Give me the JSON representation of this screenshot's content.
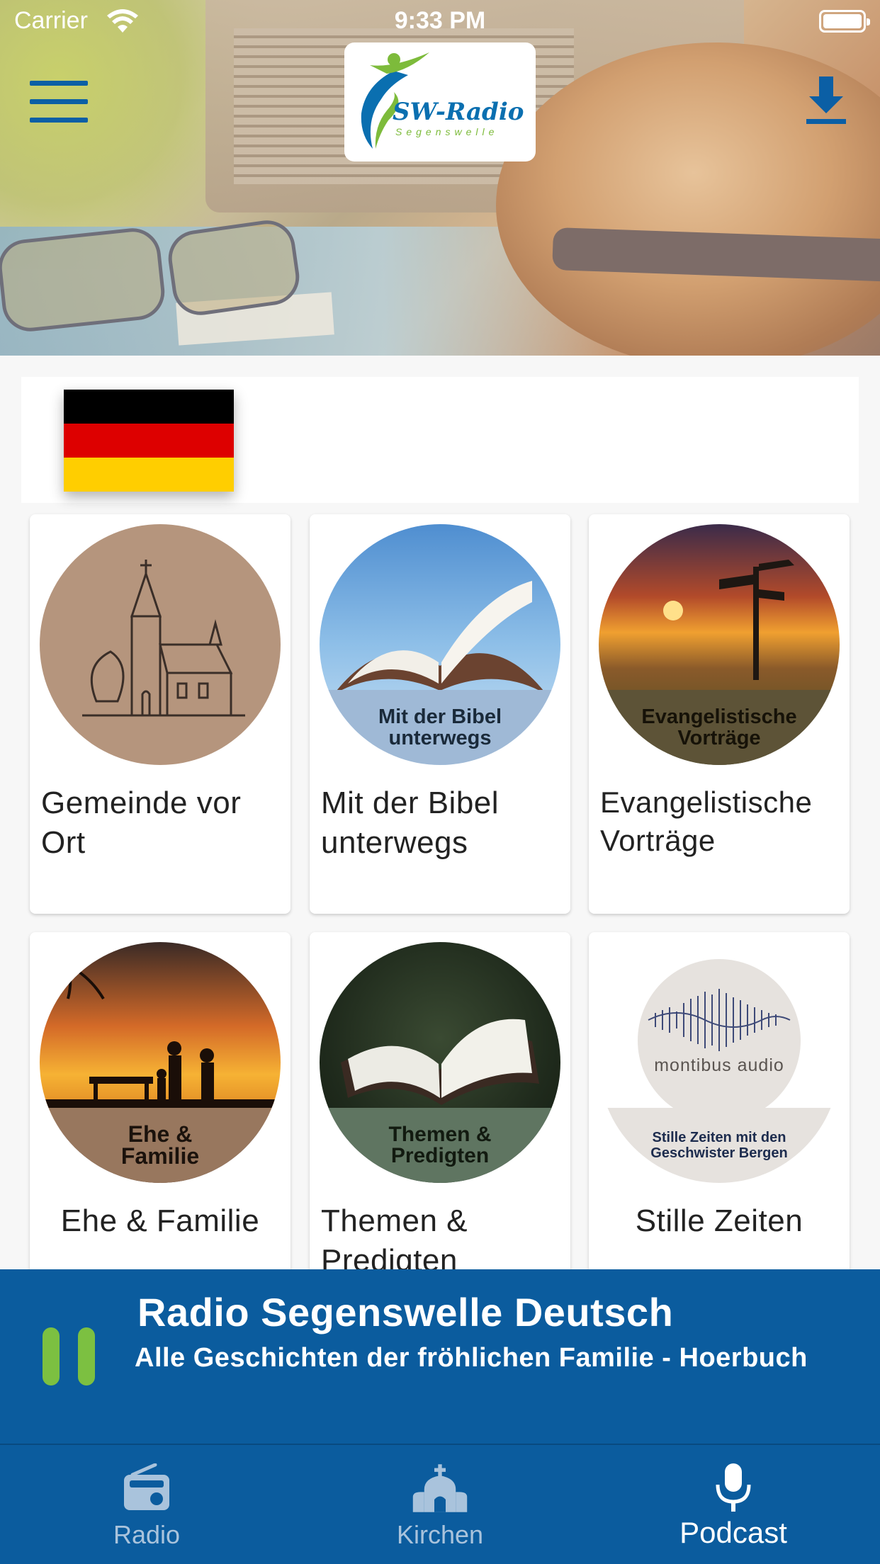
{
  "status_bar": {
    "carrier": "Carrier",
    "time": "9:33 PM"
  },
  "header": {
    "logo_title": "SW-Radio",
    "logo_subtitle": "Segenswelle",
    "menu_icon": "hamburger-menu-icon",
    "download_icon": "download-icon"
  },
  "language": {
    "selected_flag": "germany-flag-icon",
    "colors": [
      "#000000",
      "#dd0000",
      "#ffce00"
    ]
  },
  "categories": [
    {
      "title": "Gemeinde vor Ort",
      "badge": "",
      "badge_color": ""
    },
    {
      "title": "Mit der Bibel unterwegs",
      "badge": "Mit der Bibel unterwegs",
      "badge_color": "#9fb9d6"
    },
    {
      "title": "Evangelistische Vorträge",
      "badge": "Evangelistische Vorträge",
      "badge_color": "#5d5337"
    },
    {
      "title": "Ehe & Familie",
      "badge": "Ehe & Familie",
      "badge_color": "#98775e"
    },
    {
      "title": "Themen & Predigten",
      "badge": "Themen & Predigten",
      "badge_color": "#5f7561"
    },
    {
      "title": "Stille Zeiten",
      "badge": "Stille Zeiten mit den Geschwister Bergen",
      "badge_color": "#e6e2de",
      "brand": "montibus audio"
    }
  ],
  "player": {
    "title": "Radio Segenswelle Deutsch",
    "subtitle": "Alle Geschichten der fröhlichen Familie - Hoerbuch",
    "state": "playing",
    "accent": "#7cc041"
  },
  "tabs": [
    {
      "label": "Radio",
      "icon": "radio-icon",
      "active": false
    },
    {
      "label": "Kirchen",
      "icon": "church-icon",
      "active": false
    },
    {
      "label": "Podcast",
      "icon": "microphone-icon",
      "active": true
    }
  ],
  "theme": {
    "primary": "#0b5c9e",
    "background": "#f7f7f7"
  }
}
